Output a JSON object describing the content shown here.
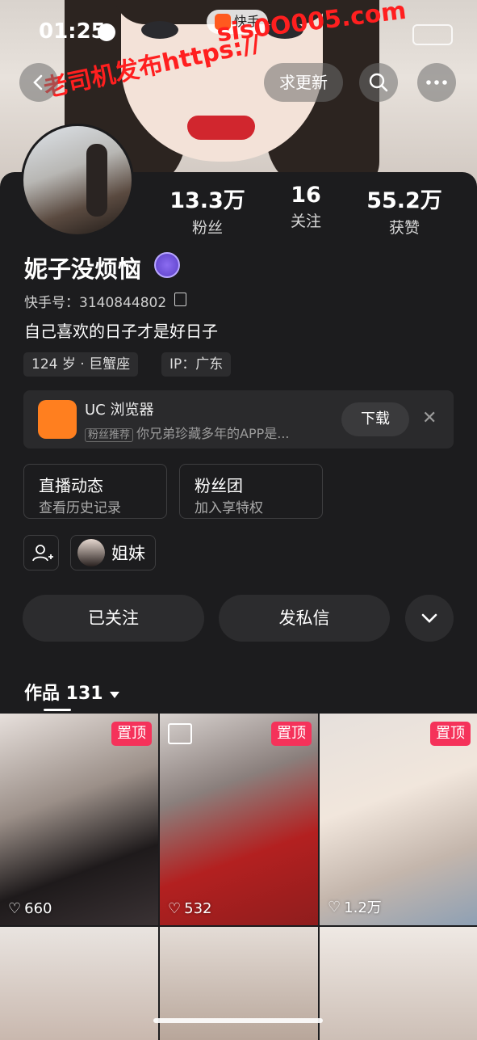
{
  "status": {
    "time": "01:25"
  },
  "app": {
    "name": "快手"
  },
  "watermark": {
    "line1": "sis0O005.com",
    "line2": "老司机发布https://"
  },
  "header": {
    "update_button": "求更新"
  },
  "profile": {
    "stats": [
      {
        "value": "13.3万",
        "label": "粉丝"
      },
      {
        "value": "16",
        "label": "关注"
      },
      {
        "value": "55.2万",
        "label": "获赞"
      }
    ],
    "name": "妮子没烦恼",
    "uid": "快手号：3140844802",
    "bio": "自己喜欢的日子才是好日子",
    "tags": [
      "124 岁 · 巨蟹座",
      "IP：广东"
    ]
  },
  "ad": {
    "title": "UC 浏览器",
    "sub_tag": "粉丝推荐",
    "sub_text": "你兄弟珍藏多年的APP是...",
    "download": "下载"
  },
  "cards": [
    {
      "title": "直播动态",
      "sub": "查看历史记录"
    },
    {
      "title": "粉丝团",
      "sub": "加入享特权"
    }
  ],
  "relations": {
    "sister": "姐妹"
  },
  "actions": {
    "followed": "已关注",
    "message": "发私信"
  },
  "works": {
    "label": "作品 131"
  },
  "posts": [
    {
      "pinned": "置顶",
      "likes": "660"
    },
    {
      "pinned": "置顶",
      "likes": "532"
    },
    {
      "pinned": "置顶",
      "likes": "1.2万"
    },
    {
      "pinned": "",
      "likes": ""
    },
    {
      "pinned": "",
      "likes": ""
    },
    {
      "pinned": "",
      "likes": ""
    }
  ]
}
